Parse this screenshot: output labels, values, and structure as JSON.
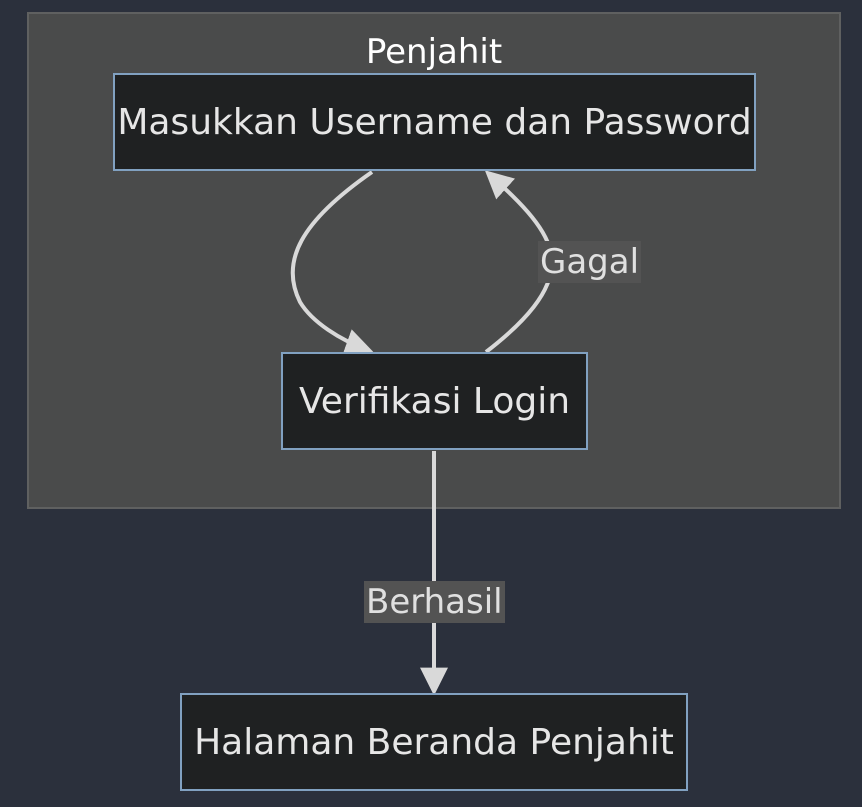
{
  "cluster": {
    "title": "Penjahit"
  },
  "nodes": {
    "login_input": "Masukkan Username dan Password",
    "verify": "Verifikasi Login",
    "home": "Halaman Beranda Penjahit"
  },
  "edges": {
    "fail_label": "Gagal",
    "success_label": "Berhasil"
  },
  "colors": {
    "background": "#2b303c",
    "cluster_fill": "#4a4b4b",
    "node_fill": "#1f2122",
    "node_border": "#81a1c1",
    "edge": "#d9d9d9"
  }
}
